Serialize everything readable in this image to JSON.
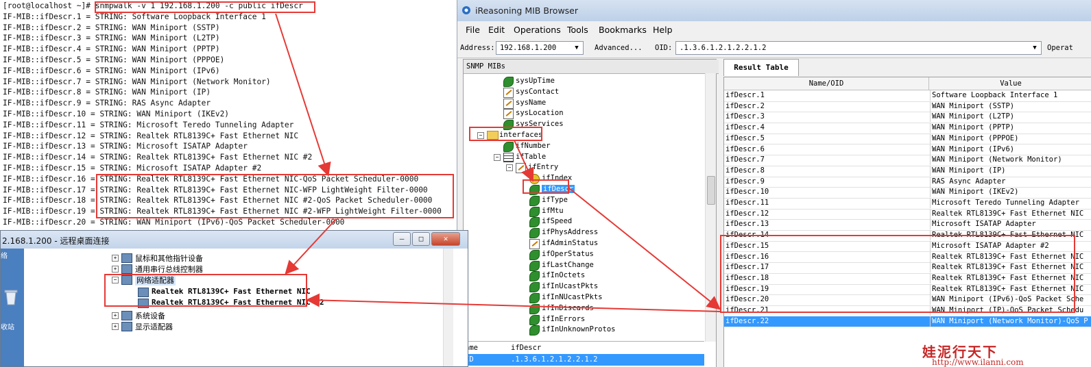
{
  "terminal": {
    "lines": [
      {
        "prompt": "[root@localhost ~]# ",
        "text": "snmpwalk -v 1 192.168.1.200 -c public ifDescr"
      },
      {
        "prompt": "",
        "text": "IF-MIB::ifDescr.1 = STRING: Software Loopback Interface 1"
      },
      {
        "prompt": "",
        "text": "IF-MIB::ifDescr.2 = STRING: WAN Miniport (SSTP)"
      },
      {
        "prompt": "",
        "text": "IF-MIB::ifDescr.3 = STRING: WAN Miniport (L2TP)"
      },
      {
        "prompt": "",
        "text": "IF-MIB::ifDescr.4 = STRING: WAN Miniport (PPTP)"
      },
      {
        "prompt": "",
        "text": "IF-MIB::ifDescr.5 = STRING: WAN Miniport (PPPOE)"
      },
      {
        "prompt": "",
        "text": "IF-MIB::ifDescr.6 = STRING: WAN Miniport (IPv6)"
      },
      {
        "prompt": "",
        "text": "IF-MIB::ifDescr.7 = STRING: WAN Miniport (Network Monitor)"
      },
      {
        "prompt": "",
        "text": "IF-MIB::ifDescr.8 = STRING: WAN Miniport (IP)"
      },
      {
        "prompt": "",
        "text": "IF-MIB::ifDescr.9 = STRING: RAS Async Adapter"
      },
      {
        "prompt": "",
        "text": "IF-MIB::ifDescr.10 = STRING: WAN Miniport (IKEv2)"
      },
      {
        "prompt": "",
        "text": "IF-MIB::ifDescr.11 = STRING: Microsoft Teredo Tunneling Adapter"
      },
      {
        "prompt": "",
        "text": "IF-MIB::ifDescr.12 = STRING: Realtek RTL8139C+ Fast Ethernet NIC"
      },
      {
        "prompt": "",
        "text": "IF-MIB::ifDescr.13 = STRING: Microsoft ISATAP Adapter"
      },
      {
        "prompt": "",
        "text": "IF-MIB::ifDescr.14 = STRING: Realtek RTL8139C+ Fast Ethernet NIC #2"
      },
      {
        "prompt": "",
        "text": "IF-MIB::ifDescr.15 = STRING: Microsoft ISATAP Adapter #2"
      },
      {
        "prompt": "",
        "text": "IF-MIB::ifDescr.16 = STRING: Realtek RTL8139C+ Fast Ethernet NIC-QoS Packet Scheduler-0000"
      },
      {
        "prompt": "",
        "text": "IF-MIB::ifDescr.17 = STRING: Realtek RTL8139C+ Fast Ethernet NIC-WFP LightWeight Filter-0000"
      },
      {
        "prompt": "",
        "text": "IF-MIB::ifDescr.18 = STRING: Realtek RTL8139C+ Fast Ethernet NIC #2-QoS Packet Scheduler-0000"
      },
      {
        "prompt": "",
        "text": "IF-MIB::ifDescr.19 = STRING: Realtek RTL8139C+ Fast Ethernet NIC #2-WFP LightWeight Filter-0000"
      },
      {
        "prompt": "",
        "text": "IF-MIB::ifDescr.20 = STRING: WAN Miniport (IPv6)-QoS Packet Scheduler-0000"
      }
    ]
  },
  "mib_browser": {
    "title": "iReasoning MIB Browser",
    "menu": [
      "File",
      "Edit",
      "Operations",
      "Tools",
      "Bookmarks",
      "Help"
    ],
    "address_label": "Address:",
    "address_value": "192.168.1.200",
    "advanced_label": "Advanced...",
    "oid_label": "OID:",
    "oid_value": ".1.3.6.1.2.1.2.2.1.2",
    "operations_label": "Operat",
    "tree_header": "SNMP MIBs",
    "tree": [
      {
        "label": "sysUpTime",
        "icon": "leaf-icon"
      },
      {
        "label": "sysContact",
        "icon": "edit-icon"
      },
      {
        "label": "sysName",
        "icon": "edit-icon"
      },
      {
        "label": "sysLocation",
        "icon": "edit-icon"
      },
      {
        "label": "sysServices",
        "icon": "leaf-icon"
      },
      {
        "label": "interfaces",
        "icon": "folder-icon"
      },
      {
        "label": "ifNumber",
        "icon": "leaf-icon"
      },
      {
        "label": "ifTable",
        "icon": "table-icon"
      },
      {
        "label": "ifEntry",
        "icon": "entry-icon"
      },
      {
        "label": "ifIndex",
        "icon": "key-icon"
      },
      {
        "label": "ifDescr",
        "icon": "leaf-icon"
      },
      {
        "label": "ifType",
        "icon": "leaf-icon"
      },
      {
        "label": "ifMtu",
        "icon": "leaf-icon"
      },
      {
        "label": "ifSpeed",
        "icon": "leaf-icon"
      },
      {
        "label": "ifPhysAddress",
        "icon": "leaf-icon"
      },
      {
        "label": "ifAdminStatus",
        "icon": "edit-icon"
      },
      {
        "label": "ifOperStatus",
        "icon": "leaf-icon"
      },
      {
        "label": "ifLastChange",
        "icon": "leaf-icon"
      },
      {
        "label": "ifInOctets",
        "icon": "leaf-icon"
      },
      {
        "label": "ifInUcastPkts",
        "icon": "leaf-icon"
      },
      {
        "label": "ifInNUcastPkts",
        "icon": "leaf-icon"
      },
      {
        "label": "ifInDiscards",
        "icon": "leaf-icon"
      },
      {
        "label": "ifInErrors",
        "icon": "leaf-icon"
      },
      {
        "label": "ifInUnknownProtos",
        "icon": "leaf-icon"
      }
    ],
    "props": {
      "col_name": "ame",
      "col_value": "ifDescr",
      "row_name": "ID",
      "row_value": ".1.3.6.1.2.1.2.2.1.2"
    },
    "result_tab": "Result Table",
    "result_columns": [
      "Name/OID",
      "Value"
    ],
    "result_rows": [
      [
        "ifDescr.1",
        "Software Loopback Interface 1"
      ],
      [
        "ifDescr.2",
        "WAN Miniport (SSTP)"
      ],
      [
        "ifDescr.3",
        "WAN Miniport (L2TP)"
      ],
      [
        "ifDescr.4",
        "WAN Miniport (PPTP)"
      ],
      [
        "ifDescr.5",
        "WAN Miniport (PPPOE)"
      ],
      [
        "ifDescr.6",
        "WAN Miniport (IPv6)"
      ],
      [
        "ifDescr.7",
        "WAN Miniport (Network Monitor)"
      ],
      [
        "ifDescr.8",
        "WAN Miniport (IP)"
      ],
      [
        "ifDescr.9",
        "RAS Async Adapter"
      ],
      [
        "ifDescr.10",
        "WAN Miniport (IKEv2)"
      ],
      [
        "ifDescr.11",
        "Microsoft Teredo Tunneling Adapter"
      ],
      [
        "ifDescr.12",
        "Realtek RTL8139C+ Fast Ethernet NIC"
      ],
      [
        "ifDescr.13",
        "Microsoft ISATAP Adapter"
      ],
      [
        "ifDescr.14",
        "Realtek RTL8139C+ Fast Ethernet NIC"
      ],
      [
        "ifDescr.15",
        "Microsoft ISATAP Adapter #2"
      ],
      [
        "ifDescr.16",
        "Realtek RTL8139C+ Fast Ethernet NIC"
      ],
      [
        "ifDescr.17",
        "Realtek RTL8139C+ Fast Ethernet NIC"
      ],
      [
        "ifDescr.18",
        "Realtek RTL8139C+ Fast Ethernet NIC"
      ],
      [
        "ifDescr.19",
        "Realtek RTL8139C+ Fast Ethernet NIC"
      ],
      [
        "ifDescr.20",
        "WAN Miniport (IPv6)-QoS Packet Sche"
      ],
      [
        "ifDescr.21",
        "WAN Miniport (IP)-QoS Packet Schedu"
      ],
      [
        "ifDescr.22",
        "WAN Miniport (Network Monitor)-QoS P"
      ]
    ]
  },
  "remote_desktop": {
    "title": "2.168.1.200 - 远程桌面连接",
    "btn_min": "–",
    "btn_max": "□",
    "btn_close": "✕",
    "desktop_labels": [
      "络",
      "收站"
    ],
    "device_manager": [
      {
        "label": "鼠标和其他指针设备",
        "expander": "+"
      },
      {
        "label": "通用串行总线控制器",
        "expander": "+"
      },
      {
        "label": "网络适配器",
        "expander": "−"
      },
      {
        "label": "Realtek RTL8139C+ Fast Ethernet NIC",
        "expander": ""
      },
      {
        "label": "Realtek RTL8139C+ Fast Ethernet NIC #2",
        "expander": ""
      },
      {
        "label": "系统设备",
        "expander": "+"
      },
      {
        "label": "显示适配器",
        "expander": "+"
      }
    ]
  },
  "watermark": {
    "brand": "娃泥行天下",
    "url": "http://www.ilanni.com"
  },
  "colors": {
    "annotation_red": "#e53935",
    "selection_blue": "#3399ff",
    "leaf_green": "#2f8f2f"
  }
}
